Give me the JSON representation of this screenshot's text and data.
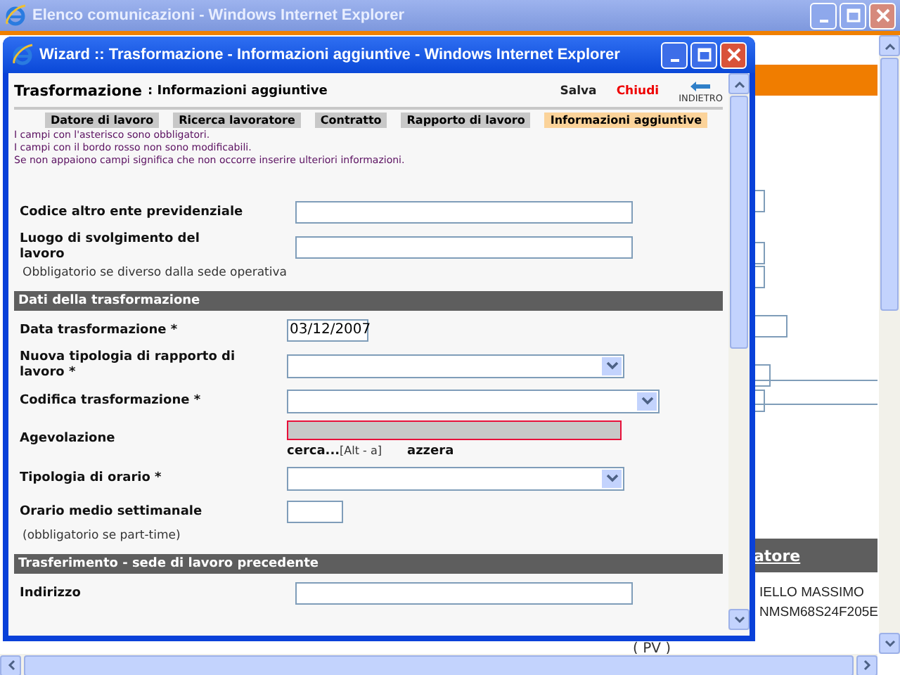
{
  "background_window": {
    "title": "Elenco comunicazioni - Windows Internet Explorer",
    "column_link": "atore",
    "row_lines": [
      "IELLO MASSIMO",
      "NMSM68S24F205E"
    ],
    "cell": "( PV )"
  },
  "popup": {
    "title": "Wizard :: Trasformazione - Informazioni aggiuntive - Windows Internet Explorer"
  },
  "header": {
    "title": "Trasformazione",
    "subtitle": ": Informazioni aggiuntive"
  },
  "actions": [
    {
      "kind": "save",
      "label": "Salva"
    },
    {
      "kind": "close",
      "label": "Chiudi"
    },
    {
      "kind": "back",
      "label": "INDIETRO"
    }
  ],
  "tabs": [
    {
      "label": "Datore di lavoro",
      "selected": false
    },
    {
      "label": "Ricerca lavoratore",
      "selected": false
    },
    {
      "label": "Contratto",
      "selected": false
    },
    {
      "label": "Rapporto di lavoro",
      "selected": false
    },
    {
      "label": "Informazioni aggiuntive",
      "selected": true
    }
  ],
  "notes": [
    "I campi con l'asterisco sono obbligatori.",
    "I campi con il bordo rosso non sono modificabili.",
    "Se non appaiono campi significa che non occorre inserire ulteriori informazioni."
  ],
  "form": [
    {
      "kind": "text",
      "label": "Codice altro ente previdenziale"
    },
    {
      "kind": "text",
      "label": "Luogo di svolgimento del lavoro"
    },
    {
      "kind": "note",
      "text": "Obbligatorio se diverso dalla sede operativa"
    },
    {
      "kind": "section",
      "text": "Dati della trasformazione"
    },
    {
      "kind": "date",
      "label": "Data trasformazione *",
      "value": "03/12/2007"
    },
    {
      "kind": "select",
      "label": "Nuova tipologia di rapporto di lavoro *"
    },
    {
      "kind": "wideselect",
      "label": "Codifica trasformazione *"
    },
    {
      "kind": "locked",
      "label": "Agevolazione",
      "search": "cerca...",
      "shortcut": "[Alt - a]",
      "reset": "azzera"
    },
    {
      "kind": "select",
      "label": "Tipologia di orario *"
    },
    {
      "kind": "short",
      "label": "Orario medio settimanale"
    },
    {
      "kind": "note",
      "text": "(obbligatorio se part-time)"
    },
    {
      "kind": "section",
      "text": "Trasferimento - sede di lavoro precedente"
    },
    {
      "kind": "text",
      "label": "Indirizzo"
    }
  ]
}
